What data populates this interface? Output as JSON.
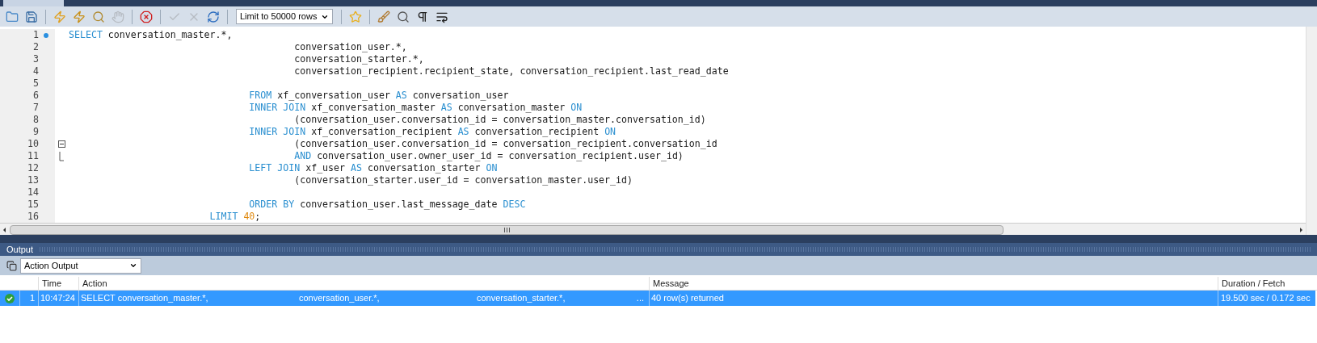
{
  "toolbar": {
    "items": [
      {
        "kind": "folder",
        "disabled": false
      },
      {
        "kind": "save",
        "disabled": false
      },
      {
        "kind": "separator"
      },
      {
        "kind": "execute",
        "disabled": false
      },
      {
        "kind": "execute-current",
        "disabled": false
      },
      {
        "kind": "explain",
        "disabled": false
      },
      {
        "kind": "stop",
        "disabled": true
      },
      {
        "kind": "separator"
      },
      {
        "kind": "toggle-error",
        "disabled": false
      },
      {
        "kind": "separator"
      },
      {
        "kind": "commit",
        "disabled": true
      },
      {
        "kind": "rollback",
        "disabled": true
      },
      {
        "kind": "autocommit",
        "disabled": false
      },
      {
        "kind": "separator"
      },
      {
        "kind": "select",
        "value": "Limit to 50000 rows"
      },
      {
        "kind": "separator"
      },
      {
        "kind": "snippet",
        "disabled": false
      },
      {
        "kind": "separator"
      },
      {
        "kind": "beautify",
        "disabled": false
      },
      {
        "kind": "find",
        "disabled": false
      },
      {
        "kind": "invisibles",
        "disabled": false
      },
      {
        "kind": "wrap",
        "disabled": false
      }
    ]
  },
  "editor": {
    "lines": [
      {
        "number": "1",
        "current": true,
        "kind": "code",
        "segments": [
          {
            "kind": "keyword",
            "text": "SELECT"
          },
          {
            "kind": "plain",
            "text": " conversation_master.*,"
          }
        ]
      },
      {
        "number": "2",
        "current": false,
        "kind": "code",
        "segments": [
          {
            "kind": "plain",
            "text": "                                        conversation_user.*,"
          }
        ]
      },
      {
        "number": "3",
        "current": false,
        "kind": "code",
        "segments": [
          {
            "kind": "plain",
            "text": "                                        conversation_starter.*,"
          }
        ]
      },
      {
        "number": "4",
        "current": false,
        "kind": "code",
        "segments": [
          {
            "kind": "plain",
            "text": "                                        conversation_recipient.recipient_state, conversation_recipient.last_read_date"
          }
        ]
      },
      {
        "number": "5",
        "current": false,
        "kind": "code"
      },
      {
        "number": "6",
        "current": false,
        "kind": "code",
        "segments": [
          {
            "kind": "keyword",
            "text": "                                FROM"
          },
          {
            "kind": "plain",
            "text": " xf_conversation_user "
          },
          {
            "kind": "keyword",
            "text": "AS"
          },
          {
            "kind": "plain",
            "text": " conversation_user"
          }
        ]
      },
      {
        "number": "7",
        "current": false,
        "kind": "code",
        "segments": [
          {
            "kind": "keyword",
            "text": "                                INNER JOIN"
          },
          {
            "kind": "plain",
            "text": " xf_conversation_master "
          },
          {
            "kind": "keyword",
            "text": "AS"
          },
          {
            "kind": "plain",
            "text": " conversation_master "
          },
          {
            "kind": "keyword",
            "text": "ON"
          }
        ]
      },
      {
        "number": "8",
        "current": false,
        "kind": "code",
        "segments": [
          {
            "kind": "plain",
            "text": "                                        (conversation_user.conversation_id = conversation_master.conversation_id)"
          }
        ]
      },
      {
        "number": "9",
        "current": false,
        "kind": "code",
        "segments": [
          {
            "kind": "keyword",
            "text": "                                INNER JOIN"
          },
          {
            "kind": "plain",
            "text": " xf_conversation_recipient "
          },
          {
            "kind": "keyword",
            "text": "AS"
          },
          {
            "kind": "plain",
            "text": " conversation_recipient "
          },
          {
            "kind": "keyword",
            "text": "ON"
          }
        ]
      },
      {
        "number": "10",
        "current": false,
        "kind": "fold-start",
        "segments": [
          {
            "kind": "plain",
            "text": "                                        (conversation_user.conversation_id = conversation_recipient.conversation_id"
          }
        ]
      },
      {
        "number": "11",
        "current": false,
        "kind": "fold-end",
        "segments": [
          {
            "kind": "keyword",
            "text": "                                        AND"
          },
          {
            "kind": "plain",
            "text": " conversation_user.owner_user_id = conversation_recipient.user_id)"
          }
        ]
      },
      {
        "number": "12",
        "current": false,
        "kind": "code",
        "segments": [
          {
            "kind": "keyword",
            "text": "                                LEFT JOIN"
          },
          {
            "kind": "plain",
            "text": " xf_user "
          },
          {
            "kind": "keyword",
            "text": "AS"
          },
          {
            "kind": "plain",
            "text": " conversation_starter "
          },
          {
            "kind": "keyword",
            "text": "ON"
          }
        ]
      },
      {
        "number": "13",
        "current": false,
        "kind": "code",
        "segments": [
          {
            "kind": "plain",
            "text": "                                        (conversation_starter.user_id = conversation_master.user_id)"
          }
        ]
      },
      {
        "number": "14",
        "current": false,
        "kind": "code"
      },
      {
        "number": "15",
        "current": false,
        "kind": "code",
        "segments": [
          {
            "kind": "keyword",
            "text": "                                ORDER BY"
          },
          {
            "kind": "plain",
            "text": " conversation_user.last_message_date "
          },
          {
            "kind": "keyword",
            "text": "DESC"
          }
        ]
      },
      {
        "number": "16",
        "current": false,
        "kind": "code",
        "segments": [
          {
            "kind": "keyword",
            "text": "                         LIMIT"
          },
          {
            "kind": "number",
            "text": " 40"
          },
          {
            "kind": "plain",
            "text": ";"
          }
        ]
      }
    ]
  },
  "output": {
    "title": "Output",
    "view": "Action Output",
    "columns": [
      "Time",
      "Action",
      "Message",
      "Duration / Fetch"
    ],
    "rows": [
      {
        "kind": "success",
        "selected": true,
        "index": "1",
        "time": "10:47:24",
        "action": [
          "SELECT conversation_master.*,",
          "conversation_user.*,",
          "conversation_starter.*,"
        ],
        "action_more": "...",
        "message": "40 row(s) returned",
        "duration": "19.500 sec / 0.172 sec"
      }
    ]
  }
}
